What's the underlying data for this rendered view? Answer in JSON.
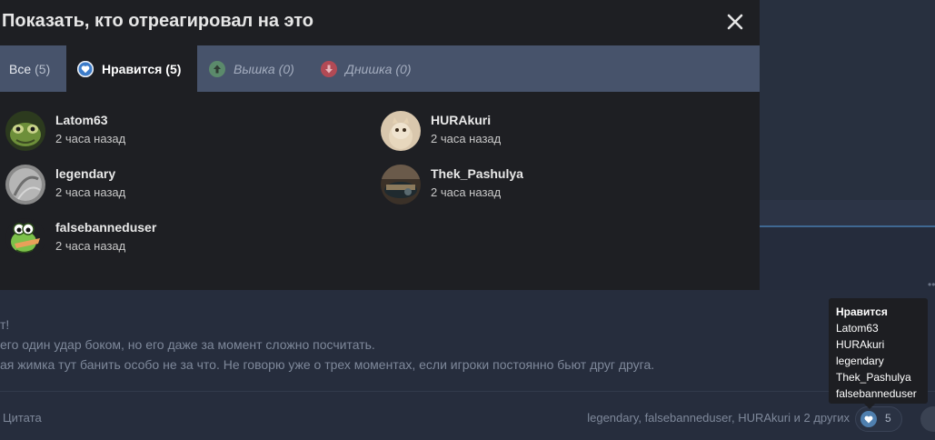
{
  "modal": {
    "title": "Показать, кто отреагировал на это",
    "close_label": "✕",
    "tabs": [
      {
        "label": "Все",
        "count": "(5)"
      },
      {
        "label": "Нравится",
        "count": "(5)",
        "icon": "heart-icon"
      },
      {
        "label": "Вышка",
        "count": "(0)",
        "icon": "arrow-up-icon"
      },
      {
        "label": "Днишка",
        "count": "(0)",
        "icon": "arrow-down-icon"
      }
    ],
    "users": [
      {
        "name": "Latom63",
        "time": "2 часа назад"
      },
      {
        "name": "HURAkuri",
        "time": "2 часа назад"
      },
      {
        "name": "legendary",
        "time": "2 часа назад"
      },
      {
        "name": "Thek_Pashulya",
        "time": "2 часа назад"
      },
      {
        "name": "falsebanneduser",
        "time": "2 часа назад"
      }
    ]
  },
  "post": {
    "lines": [
      "т!",
      "его один удар боком, но его даже за момент сложно посчитать.",
      "ая жимка тут банить особо не за что. Не говорю уже о трех моментах, если игроки постоянно бьют друг друга."
    ],
    "quote_label": "Цитата",
    "reacted_summary": "legendary, falsebanneduser, HURAkuri и 2 других",
    "reaction_count": "5"
  },
  "tooltip": {
    "title": "Нравится",
    "names": [
      "Latom63",
      "HURAkuri",
      "legendary",
      "Thek_Pashulya",
      "falsebanneduser"
    ]
  },
  "colors": {
    "modal_bg": "#1e1f23",
    "tab_bar": "#47536b",
    "like_blue": "#3d7cc9",
    "up_green": "#5b8a6b",
    "down_red": "#b24a55"
  }
}
